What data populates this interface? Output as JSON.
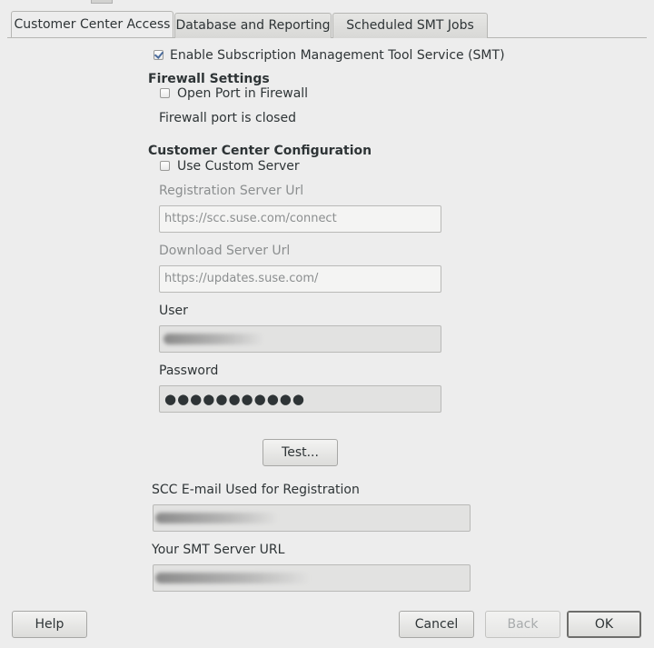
{
  "tabs": [
    {
      "label": "Customer Center Access",
      "active": true
    },
    {
      "label": "Database and Reporting",
      "active": false
    },
    {
      "label": "Scheduled SMT Jobs",
      "active": false
    }
  ],
  "enable_smt": {
    "label": "Enable Subscription Management Tool Service (SMT)",
    "checked": true
  },
  "firewall": {
    "heading": "Firewall Settings",
    "open_port_label": "Open Port in Firewall",
    "open_port_checked": false,
    "status": "Firewall port is closed"
  },
  "customer_center": {
    "heading": "Customer Center Configuration",
    "custom_server_label": "Use Custom Server",
    "custom_server_checked": false,
    "registration_url_label": "Registration Server Url",
    "registration_url_value": "https://scc.suse.com/connect",
    "download_url_label": "Download Server Url",
    "download_url_value": "https://updates.suse.com/",
    "user_label": "User",
    "password_label": "Password",
    "password_value": "●●●●●●●●●●●"
  },
  "test_button": "Test...",
  "scc_email_label": "SCC E-mail Used for Registration",
  "smt_server_url_label": "Your SMT Server URL",
  "buttons": {
    "help": "Help",
    "cancel": "Cancel",
    "back": "Back",
    "ok": "OK"
  }
}
